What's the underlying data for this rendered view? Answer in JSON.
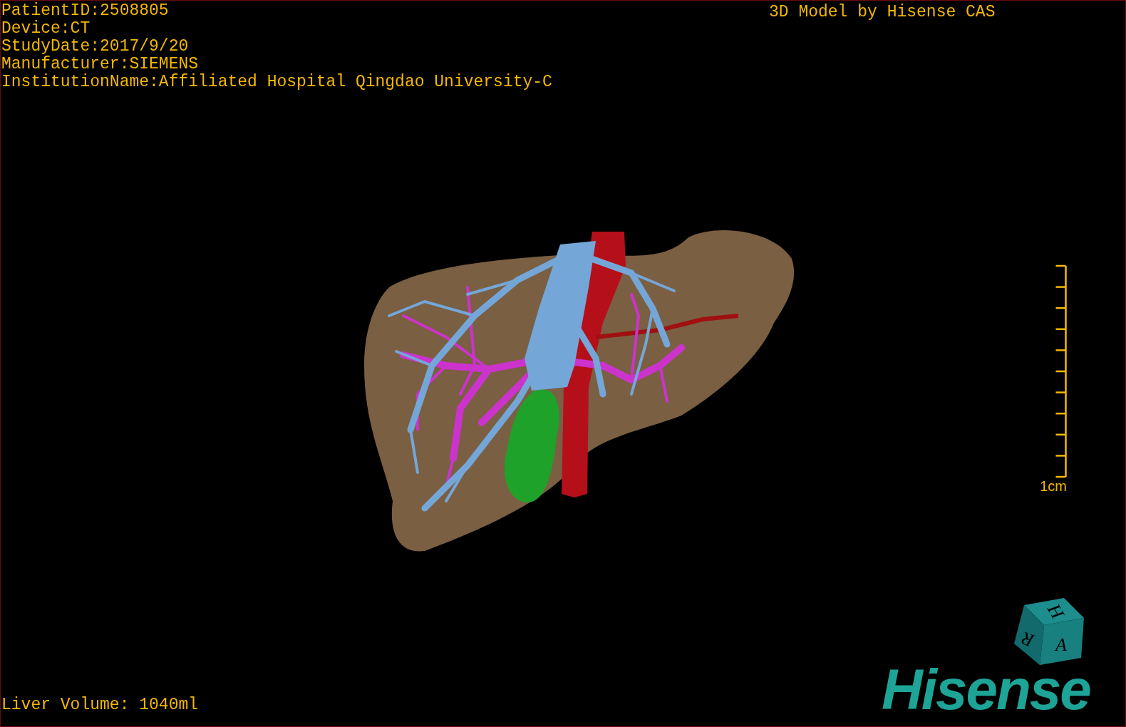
{
  "header": {
    "lines": [
      "PatientID:2508805",
      "Device:CT",
      "StudyDate:2017/9/20",
      "Manufacturer:SIEMENS",
      "InstitutionName:Affiliated Hospital Qingdao University-C"
    ]
  },
  "model_credit": "3D Model by Hisense CAS",
  "scale_bar": {
    "label": "1cm"
  },
  "orientation_cube": {
    "faces": [
      "H",
      "R",
      "A"
    ]
  },
  "logo": {
    "text": "Hisense"
  },
  "footer": {
    "liver_volume": "Liver Volume: 1040ml"
  }
}
